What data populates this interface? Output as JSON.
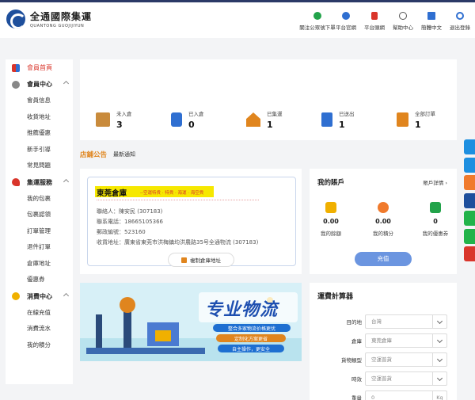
{
  "header": {
    "logo_cn": "全通國際集運",
    "logo_en": "QUANTONG GUOJIJIYUN",
    "nav": [
      {
        "label": "關注公眾號下單",
        "icon": "check-circle-icon",
        "color": "#22a34a"
      },
      {
        "label": "平台官網",
        "icon": "globe-icon",
        "color": "#2f6fd1"
      },
      {
        "label": "平台頭網",
        "icon": "phone-icon",
        "color": "#d9352b"
      },
      {
        "label": "幫助中心",
        "icon": "headset-icon",
        "color": "#555555"
      },
      {
        "label": "簡體中文",
        "icon": "language-icon",
        "color": "#2f6fd1"
      },
      {
        "label": "退出登錄",
        "icon": "power-icon",
        "color": "#2f6fd1"
      }
    ]
  },
  "sidebar": {
    "home": "會員首頁",
    "groups": [
      {
        "label": "會員中心",
        "icon": "member-icon",
        "items": [
          "會員信息",
          "收貨地址",
          "推薦優惠",
          "新手引導",
          "常見問題"
        ]
      },
      {
        "label": "集運服務",
        "icon": "rocket-icon",
        "items": [
          "我的包裹",
          "包裹認領",
          "訂單管理",
          "退件訂單",
          "倉庫地址",
          "優惠券"
        ]
      },
      {
        "label": "消費中心",
        "icon": "coin-icon",
        "items": [
          "在線充值",
          "消費流水",
          "我的積分"
        ]
      }
    ]
  },
  "stats": [
    {
      "label": "未入倉",
      "value": "3",
      "icon": "box-icon",
      "color": "#c98b3c"
    },
    {
      "label": "已入倉",
      "value": "0",
      "icon": "phone-check-icon",
      "color": "#2f6fd1"
    },
    {
      "label": "已集運",
      "value": "1",
      "icon": "house-icon",
      "color": "#e0851e"
    },
    {
      "label": "已送出",
      "value": "1",
      "icon": "document-icon",
      "color": "#2f6fd1"
    },
    {
      "label": "全部訂單",
      "value": "1",
      "icon": "clipboard-icon",
      "color": "#e0851e"
    }
  ],
  "notice": {
    "title": "店鋪公告",
    "news": "最新通知"
  },
  "warehouse": {
    "title": "東莞倉庫",
    "subtitle": "--空運特貨 · 特貨 · 海運 · 海空貨",
    "contact": "聯絡人：陳安民 (307183)",
    "phone": "聯系電話：18665105366",
    "postal": "郵政編號：523160",
    "address": "收貨地址：廣東省東莞市洪梅鎮均洪農路35号全通物流 (307183)",
    "copy_button": "複制倉庫地址"
  },
  "account": {
    "title": "我的賬戶",
    "details_link": "賬戶詳情",
    "cols": [
      {
        "value": "0.00",
        "label": "我的餘額",
        "color": "#f0b000"
      },
      {
        "value": "0.00",
        "label": "我的積分",
        "color": "#f07a2c"
      },
      {
        "value": "0",
        "label": "我的優惠券",
        "color": "#22a34a"
      }
    ],
    "recharge": "充值"
  },
  "banner": {
    "headline": "专业物流",
    "lines": [
      "整合多家物流价格更优",
      "定制化方案更省",
      "自主操作，更安全"
    ]
  },
  "calc": {
    "title": "運費計算器",
    "rows": [
      {
        "label": "目的地",
        "value": "台灣",
        "type": "select"
      },
      {
        "label": "倉庫",
        "value": "東莞倉庫",
        "type": "select"
      },
      {
        "label": "貨物類型",
        "value": "空運普貨",
        "type": "select"
      },
      {
        "label": "時效",
        "value": "空運普貨",
        "type": "select"
      },
      {
        "label": "重量",
        "value": "0",
        "type": "input",
        "unit": "Kg"
      }
    ]
  },
  "float_bar": [
    {
      "icon": "chat-icon",
      "color": "#1e8fe0"
    },
    {
      "icon": "qq-icon",
      "color": "#1e8fe0"
    },
    {
      "icon": "phone-icon",
      "color": "#f07a2c"
    },
    {
      "icon": "facebook-icon",
      "color": "#1e4f9c"
    },
    {
      "icon": "line-icon",
      "color": "#22b34a"
    },
    {
      "icon": "wechat-icon",
      "color": "#22b34a"
    },
    {
      "icon": "qr-icon",
      "color": "#d9352b"
    }
  ]
}
